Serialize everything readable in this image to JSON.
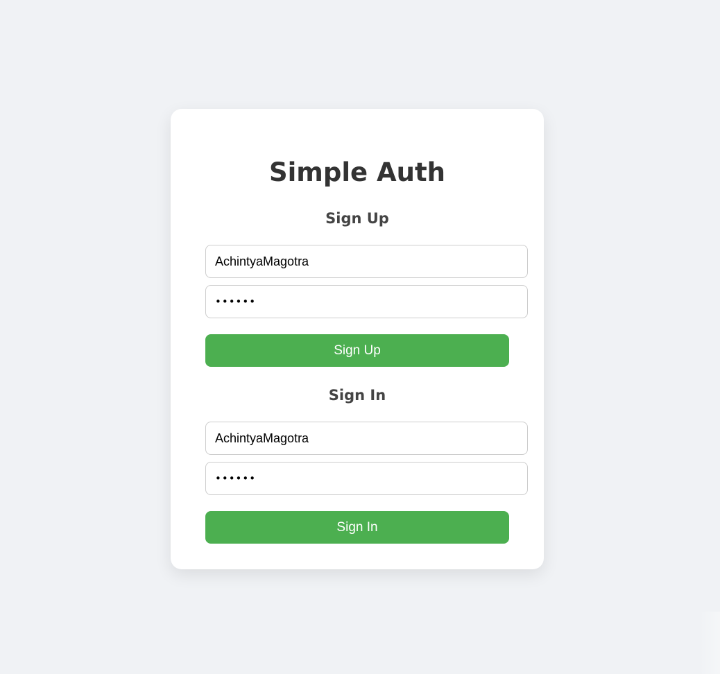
{
  "app": {
    "title": "Simple Auth"
  },
  "signup": {
    "heading": "Sign Up",
    "username_value": "AchintyaMagotra",
    "password_value": "••••••",
    "button_label": "Sign Up"
  },
  "signin": {
    "heading": "Sign In",
    "username_value": "AchintyaMagotra",
    "password_value": "••••••",
    "button_label": "Sign In"
  },
  "colors": {
    "background": "#f0f2f5",
    "card": "#ffffff",
    "accent": "#4caf50",
    "title": "#333333",
    "heading": "#444444"
  }
}
